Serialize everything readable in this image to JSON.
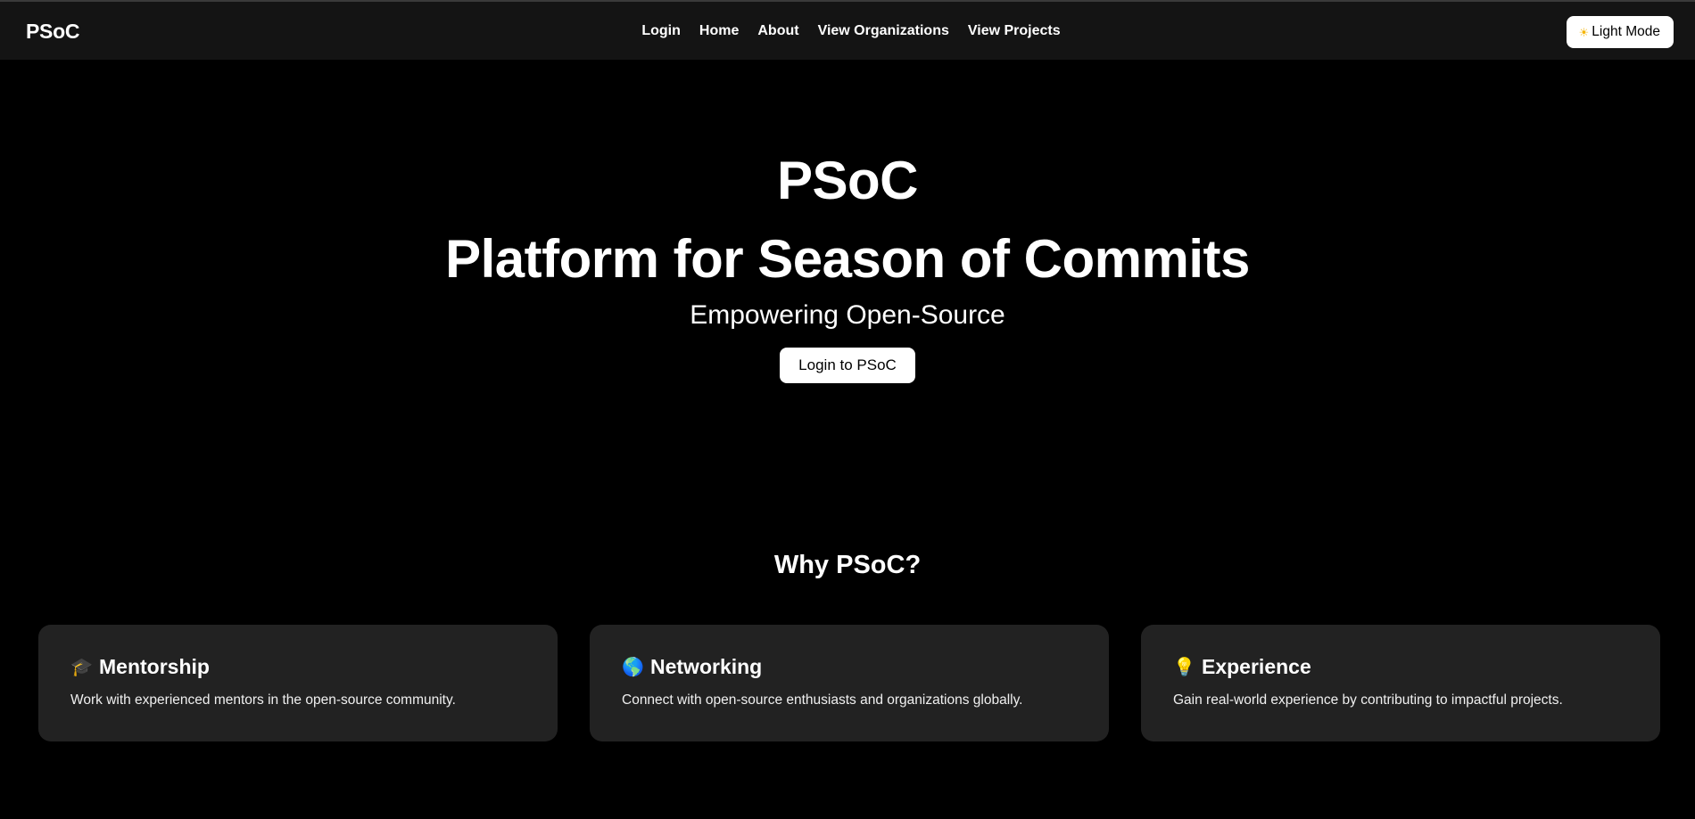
{
  "navbar": {
    "brand": "PSoC",
    "links": [
      "Login",
      "Home",
      "About",
      "View Organizations",
      "View Projects"
    ],
    "mode_toggle": {
      "icon": "sun-icon",
      "glyph": "☀",
      "label": "Light Mode"
    }
  },
  "hero": {
    "title": "PSoC",
    "subtitle": "Platform for Season of Commits",
    "tagline": "Empowering Open-Source",
    "button_label": "Login to PSoC"
  },
  "why": {
    "title": "Why PSoC?",
    "cards": [
      {
        "icon": "graduation-cap-icon",
        "glyph": "🎓",
        "title": "Mentorship",
        "description": "Work with experienced mentors in the open-source community."
      },
      {
        "icon": "globe-icon",
        "glyph": "🌎",
        "title": "Networking",
        "description": "Connect with open-source enthusiasts and organizations globally."
      },
      {
        "icon": "lightbulb-icon",
        "glyph": "💡",
        "title": "Experience",
        "description": "Gain real-world experience by contributing to impactful projects."
      }
    ]
  },
  "colors": {
    "background": "#000000",
    "navbar": "#141414",
    "card": "#222222",
    "text": "#ffffff",
    "button_bg": "#ffffff",
    "sun_accent": "#f5b400"
  }
}
